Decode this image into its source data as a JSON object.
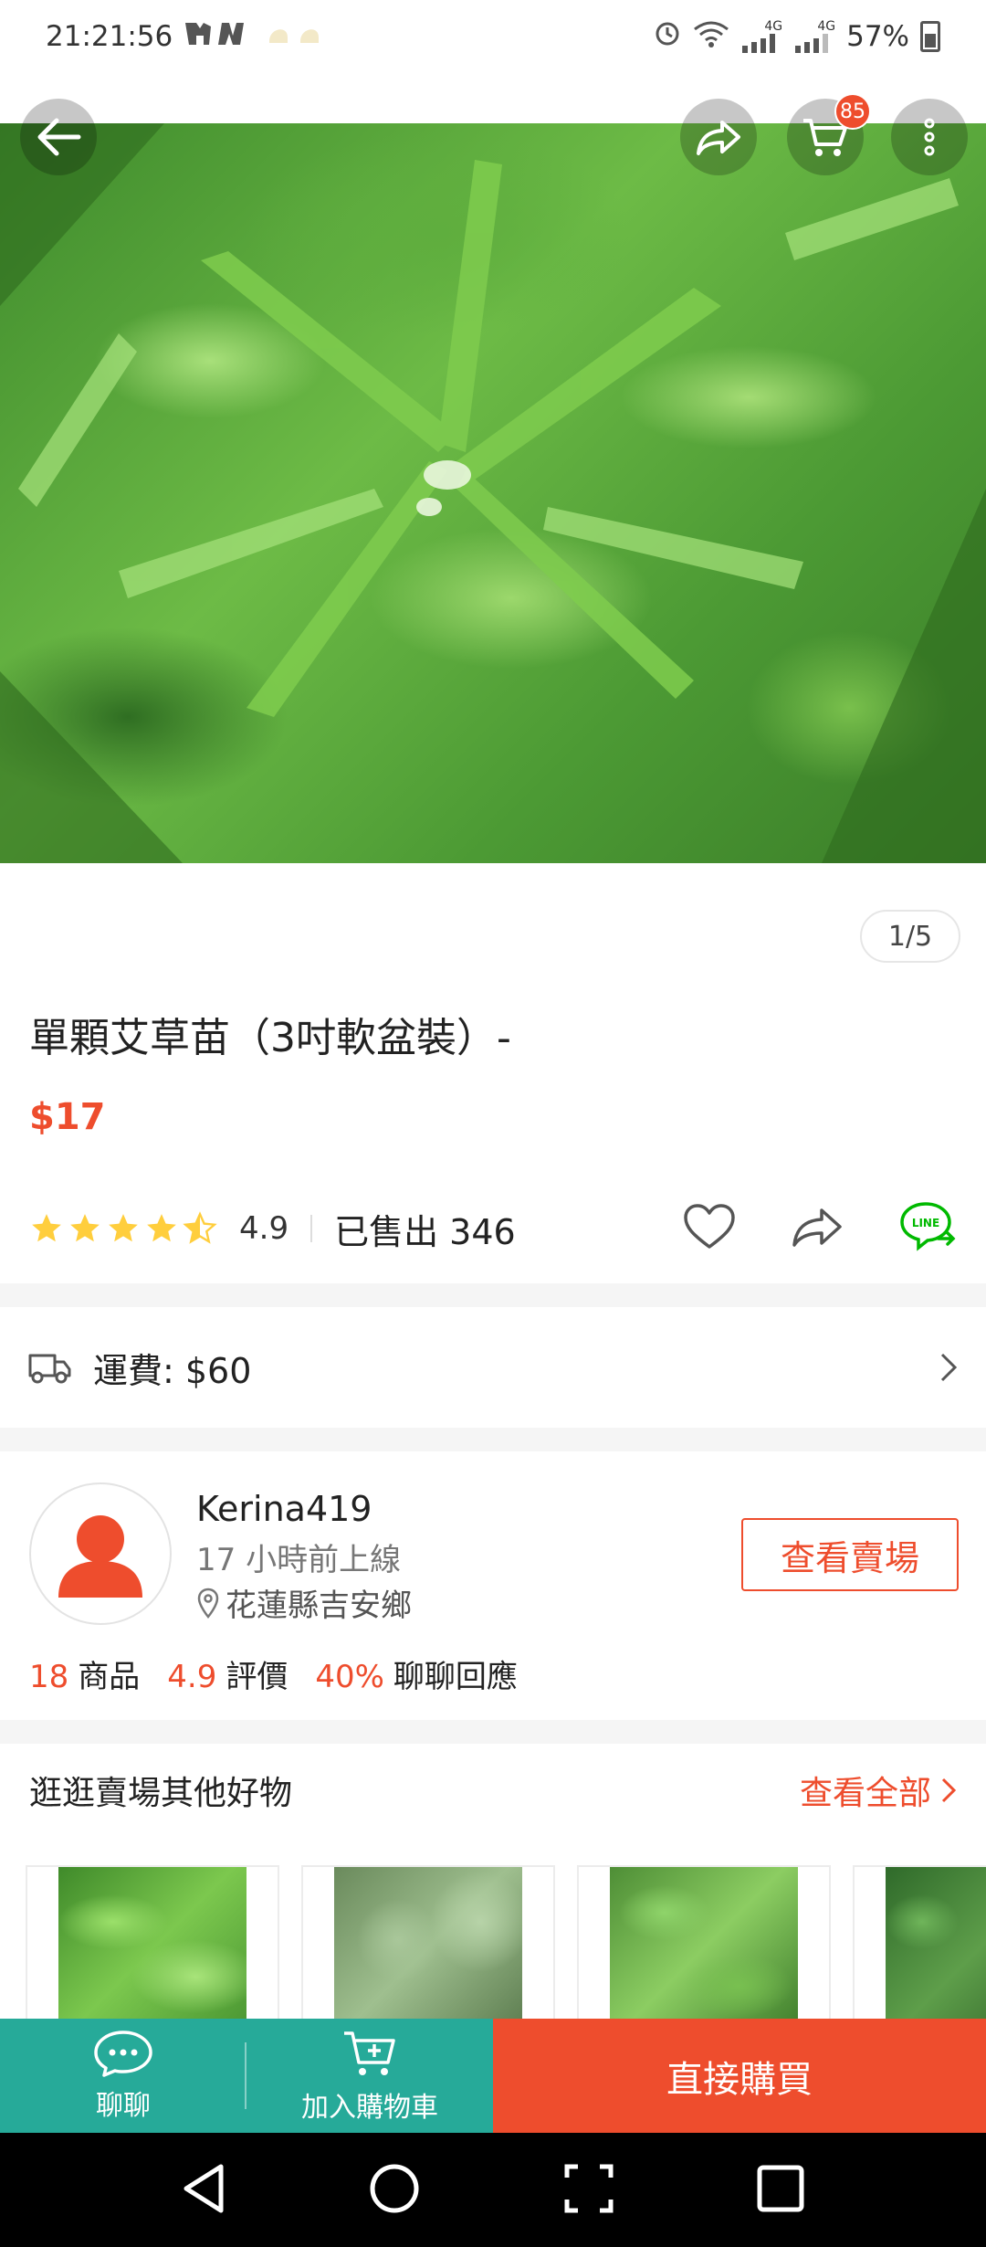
{
  "status_bar": {
    "time": "21:21:56",
    "network_label_1": "4G",
    "network_label_2": "4G",
    "battery": "57%"
  },
  "top_bar": {
    "cart_badge": "85"
  },
  "gallery": {
    "page_indicator": "1/5"
  },
  "product": {
    "title": "單顆艾草苗（3吋軟盆裝）-",
    "price": "$17",
    "rating": "4.9",
    "rating_stars": 4.5,
    "sold": "已售出 346"
  },
  "shipping": {
    "label": "運費: $60"
  },
  "shop": {
    "name": "Kerina419",
    "online": "17 小時前上線",
    "location": "花蓮縣吉安鄉",
    "view_shop": "查看賣場",
    "stats": {
      "products_num": "18",
      "products_label": "商品",
      "rating_num": "4.9",
      "rating_label": "評價",
      "response_num": "40%",
      "response_label": "聊聊回應"
    }
  },
  "more_from_shop": {
    "title": "逛逛賣場其他好物",
    "view_all": "查看全部"
  },
  "bottom_bar": {
    "chat": "聊聊",
    "add_to_cart": "加入購物車",
    "buy_now": "直接購買"
  },
  "colors": {
    "accent": "#ee4d2d",
    "teal": "#26aa99",
    "star": "#ffce3d",
    "line_green": "#00b900"
  }
}
